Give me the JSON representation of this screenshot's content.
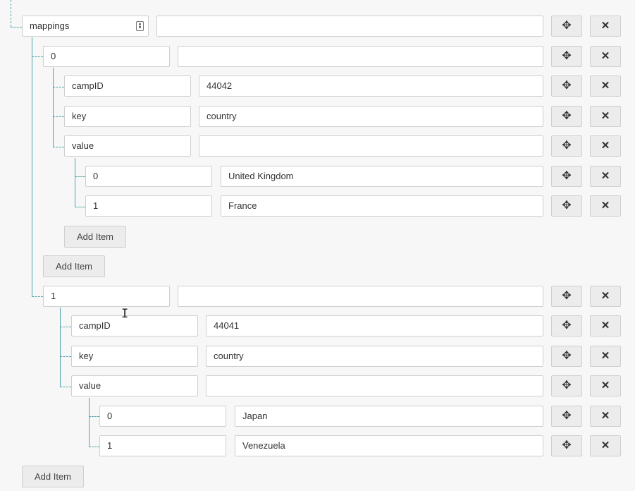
{
  "tree": {
    "root_key": "mappings",
    "move_icon": "✥",
    "delete_icon": "✕",
    "add_item_label": "Add Item",
    "items": [
      {
        "index": "0",
        "fields": [
          {
            "key": "campID",
            "value": "44042"
          },
          {
            "key": "key",
            "value": "country"
          },
          {
            "key": "value",
            "value": ""
          }
        ],
        "value_items": [
          {
            "index": "0",
            "value": "United Kingdom"
          },
          {
            "index": "1",
            "value": "France"
          }
        ]
      },
      {
        "index": "1",
        "fields": [
          {
            "key": "campID",
            "value": "44041"
          },
          {
            "key": "key",
            "value": "country"
          },
          {
            "key": "value",
            "value": ""
          }
        ],
        "value_items": [
          {
            "index": "0",
            "value": "Japan"
          },
          {
            "index": "1",
            "value": "Venezuela"
          }
        ]
      }
    ]
  },
  "colors": {
    "connector": "#4fa3a8",
    "background": "#f7f7f7",
    "button_bg": "#ececec",
    "border": "#cfcfcf"
  }
}
